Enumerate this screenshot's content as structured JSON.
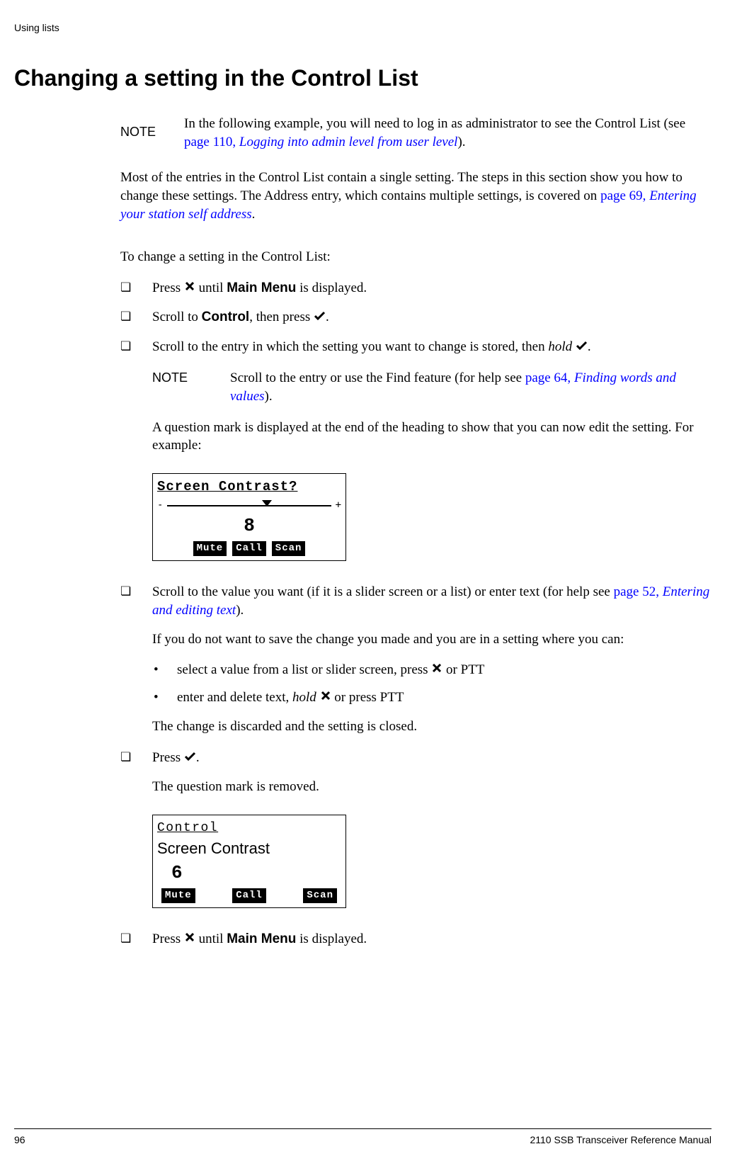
{
  "header": {
    "section": "Using lists"
  },
  "title": "Changing a setting in the Control List",
  "note1": {
    "label": "NOTE",
    "text_a": "In the following example, you will need to log in as administrator to see the Control List (see ",
    "link_a": "page 110, ",
    "link_b": "Logging into admin level from user level",
    "text_b": ")."
  },
  "para1": {
    "a": "Most of the entries in the Control List contain a single setting. The steps in this section show you how to change these settings. The Address entry, which contains multiple settings, is covered on ",
    "link_a": "page 69, ",
    "link_b": "Entering your station self address",
    "b": "."
  },
  "intro": "To change a setting in the Control List:",
  "steps": {
    "s1": {
      "a": "Press ",
      "b": " until ",
      "bold": "Main Menu",
      "c": " is displayed."
    },
    "s2": {
      "a": "Scroll to ",
      "bold": "Control",
      "b": ", then press ",
      "c": "."
    },
    "s3": {
      "a": "Scroll to the entry in which the setting you want to change is stored, then ",
      "italic": "hold",
      "b": " ",
      "c": "."
    },
    "note2": {
      "label": "NOTE",
      "a": "Scroll to the entry or use the Find feature (for help see ",
      "link_a": "page 64, ",
      "link_b": "Finding words and values",
      "b": ")."
    },
    "s3p": "A question mark is displayed at the end of the heading to show that you can now edit the setting. For example:",
    "s4": {
      "a": "Scroll to the value you want (if it is a slider screen or a list) or enter text (for help see ",
      "link_a": "page 52, ",
      "link_b": "Entering and editing text",
      "b": ").",
      "p2": "If you do not want to save the change you made and you are in a setting where you can:",
      "b1a": "select a value from a list or slider screen, press ",
      "b1b": " or PTT",
      "b2a": "enter and delete text, ",
      "b2italic": "hold",
      "b2b": " ",
      "b2c": " or press PTT",
      "p3": "The change is discarded and the setting is closed."
    },
    "s5": {
      "a": "Press ",
      "b": ".",
      "p2": "The question mark is removed."
    },
    "s6": {
      "a": "Press ",
      "b": " until ",
      "bold": "Main Menu",
      "c": " is displayed."
    }
  },
  "lcd1": {
    "title": "Screen Contrast?",
    "minus": "-",
    "plus": "+",
    "value": "8",
    "btn1": "Mute",
    "btn2": "Call",
    "btn3": "Scan"
  },
  "lcd2": {
    "title": "Control",
    "subtitle": "Screen Contrast",
    "value": "6",
    "btn1": "Mute",
    "btn2": "Call",
    "btn3": "Scan"
  },
  "footer": {
    "page": "96",
    "doc": "2110 SSB Transceiver Reference Manual"
  }
}
